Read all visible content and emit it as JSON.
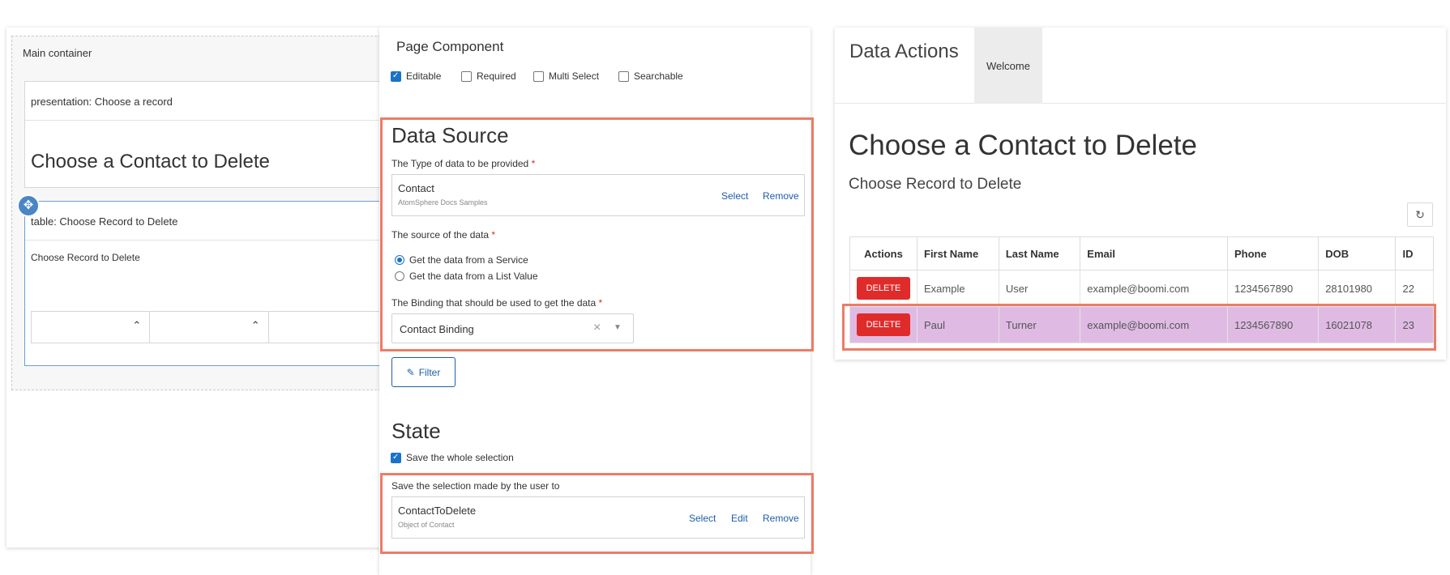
{
  "canvas": {
    "main_container_label": "Main container",
    "presentation_header": "presentation: Choose a record",
    "presentation_title": "Choose a Contact to Delete",
    "table_header": "table: Choose Record to Delete",
    "table_subtitle": "Choose Record to Delete",
    "move_icon": "move-arrows-icon"
  },
  "properties": {
    "title": "Page Component",
    "options": [
      {
        "label": "Editable",
        "checked": true
      },
      {
        "label": "Required",
        "checked": false
      },
      {
        "label": "Multi Select",
        "checked": false
      },
      {
        "label": "Searchable",
        "checked": false
      }
    ],
    "data_source": {
      "title": "Data Source",
      "type_label": "The Type of data to be provided",
      "type_name": "Contact",
      "type_source": "AtomSphere Docs Samples",
      "select_label": "Select",
      "remove_label": "Remove",
      "source_label": "The source of the data",
      "source_options": [
        {
          "label": "Get the data from a Service",
          "selected": true
        },
        {
          "label": "Get the data from a List Value",
          "selected": false
        }
      ],
      "binding_label": "The Binding that should be used to get the data",
      "binding_value": "Contact Binding",
      "required_mark": "*"
    },
    "filter_label": "Filter",
    "state": {
      "title": "State",
      "save_whole_label": "Save the whole selection",
      "save_whole_checked": true,
      "save_to_label": "Save the selection made by the user to",
      "value_name": "ContactToDelete",
      "value_type": "Object of Contact",
      "select_label": "Select",
      "edit_label": "Edit",
      "remove_label": "Remove"
    }
  },
  "preview": {
    "title": "Data Actions",
    "tab": "Welcome",
    "heading": "Choose a Contact to Delete",
    "subheading": "Choose Record to Delete",
    "refresh_icon": "refresh-icon",
    "columns": [
      "Actions",
      "First Name",
      "Last Name",
      "Email",
      "Phone",
      "DOB",
      "ID"
    ],
    "delete_label": "DELETE",
    "rows": [
      {
        "first": "Example",
        "last": "User",
        "email": "example@boomi.com",
        "phone": "1234567890",
        "dob": "28101980",
        "id": "22",
        "selected": false
      },
      {
        "first": "Paul",
        "last": "Turner",
        "email": "example@boomi.com",
        "phone": "1234567890",
        "dob": "16021078",
        "id": "23",
        "selected": true
      }
    ]
  },
  "colors": {
    "highlight": "#ec7c66",
    "accent": "#1a73c8",
    "delete": "#e02b2b",
    "selected_row": "#dfbbe4"
  }
}
